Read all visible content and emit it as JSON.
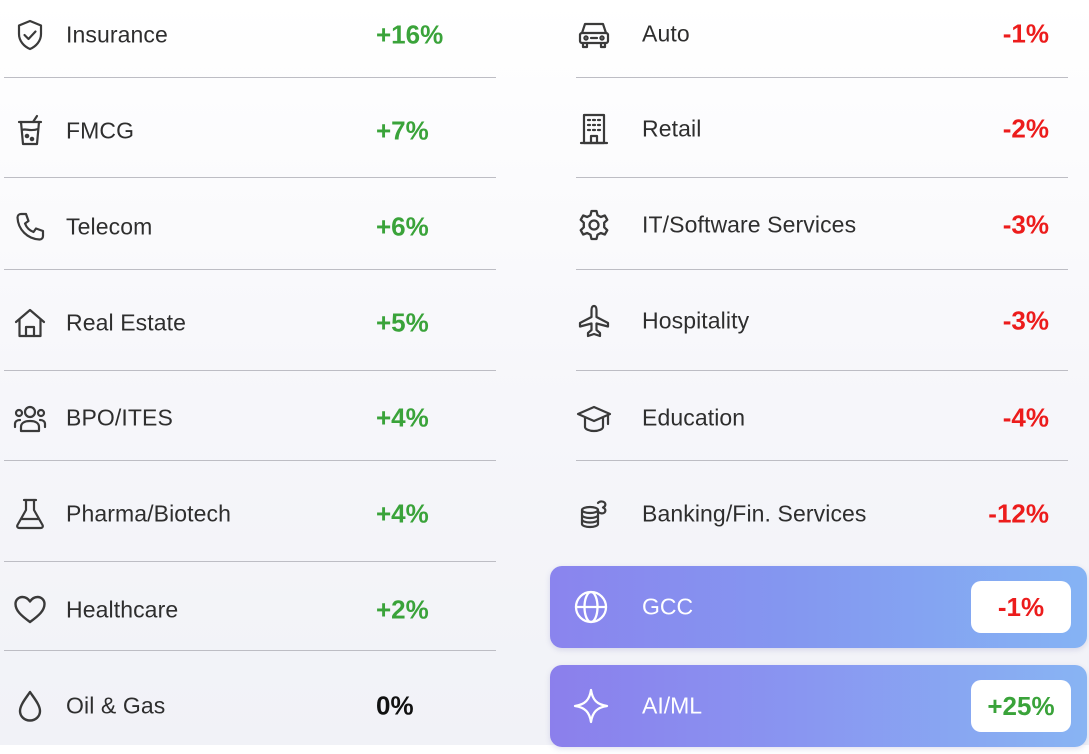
{
  "left_sectors": [
    {
      "name": "Insurance",
      "change": "+16%",
      "icon": "shield-check-icon",
      "trend": "positive"
    },
    {
      "name": "FMCG",
      "change": "+7%",
      "icon": "drink-cup-icon",
      "trend": "positive"
    },
    {
      "name": "Telecom",
      "change": "+6%",
      "icon": "phone-icon",
      "trend": "positive"
    },
    {
      "name": "Real Estate",
      "change": "+5%",
      "icon": "house-icon",
      "trend": "positive"
    },
    {
      "name": "BPO/ITES",
      "change": "+4%",
      "icon": "people-group-icon",
      "trend": "positive"
    },
    {
      "name": "Pharma/Biotech",
      "change": "+4%",
      "icon": "flask-icon",
      "trend": "positive"
    },
    {
      "name": "Healthcare",
      "change": "+2%",
      "icon": "heart-icon",
      "trend": "positive"
    },
    {
      "name": "Oil & Gas",
      "change": "0%",
      "icon": "drop-icon",
      "trend": "neutral"
    }
  ],
  "right_sectors": [
    {
      "name": "Auto",
      "change": "-1%",
      "icon": "car-icon",
      "trend": "negative"
    },
    {
      "name": "Retail",
      "change": "-2%",
      "icon": "building-icon",
      "trend": "negative"
    },
    {
      "name": "IT/Software Services",
      "change": "-3%",
      "icon": "gear-icon",
      "trend": "negative"
    },
    {
      "name": "Hospitality",
      "change": "-3%",
      "icon": "airplane-icon",
      "trend": "negative"
    },
    {
      "name": "Education",
      "change": "-4%",
      "icon": "graduation-cap-icon",
      "trend": "negative"
    },
    {
      "name": "Banking/Fin. Services",
      "change": "-12%",
      "icon": "coins-icon",
      "trend": "negative"
    }
  ],
  "highlighted_sectors": [
    {
      "name": "GCC",
      "change": "-1%",
      "icon": "globe-icon",
      "trend": "negative"
    },
    {
      "name": "AI/ML",
      "change": "+25%",
      "icon": "sparkle-icon",
      "trend": "positive"
    }
  ],
  "colors": {
    "positive": "#3aa33a",
    "negative": "#ec1c1c",
    "neutral": "#111111",
    "highlight_start": "#8a84ee",
    "highlight_end": "#85b3f4",
    "label_text": "#2e2e2e",
    "divider": "#bdbdc4"
  }
}
